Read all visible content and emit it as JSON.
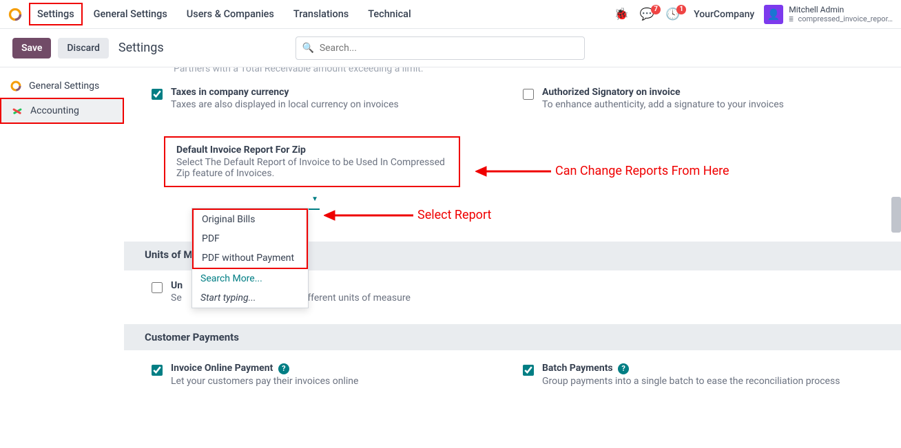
{
  "topnav": {
    "app": "Settings",
    "items": [
      "General Settings",
      "Users & Companies",
      "Translations",
      "Technical"
    ]
  },
  "systray": {
    "msg_badge": "7",
    "activity_badge": "1",
    "company": "YourCompany",
    "user_name": "Mitchell Admin",
    "db_name": "compressed_invoice_repor…"
  },
  "subbar": {
    "save": "Save",
    "discard": "Discard",
    "breadcrumb": "Settings",
    "search_placeholder": "Search..."
  },
  "sidebar": {
    "items": [
      {
        "label": "General Settings"
      },
      {
        "label": "Accounting"
      }
    ]
  },
  "cut_line": "Partners with a Total Receivable amount exceeding a limit.",
  "settings": {
    "taxes_title": "Taxes in company currency",
    "taxes_desc": "Taxes are also displayed in local currency on invoices",
    "signatory_title": "Authorized Signatory on invoice",
    "signatory_desc": "To enhance authenticity, add a signature to your invoices",
    "zip_title": "Default Invoice Report For Zip",
    "zip_desc": "Select The Default Report of Invoice to be Used In Compressed Zip feature of Invoices.",
    "uom_section": "Units of Measure",
    "uom_title_partial": "Un",
    "uom_desc_prefix": "Se",
    "uom_desc_suffix": "ifferent units of measure",
    "cust_pay_section": "Customer Payments",
    "online_title": "Invoice Online Payment",
    "online_desc": "Let your customers pay their invoices online",
    "batch_title": "Batch Payments",
    "batch_desc": "Group payments into a single batch to ease the reconciliation process"
  },
  "dropdown": {
    "options": [
      "Original Bills",
      "PDF",
      "PDF without Payment"
    ],
    "search_more": "Search More...",
    "start_typing": "Start typing..."
  },
  "annotations": {
    "change_reports": "Can Change Reports From Here",
    "select_report": "Select Report"
  }
}
